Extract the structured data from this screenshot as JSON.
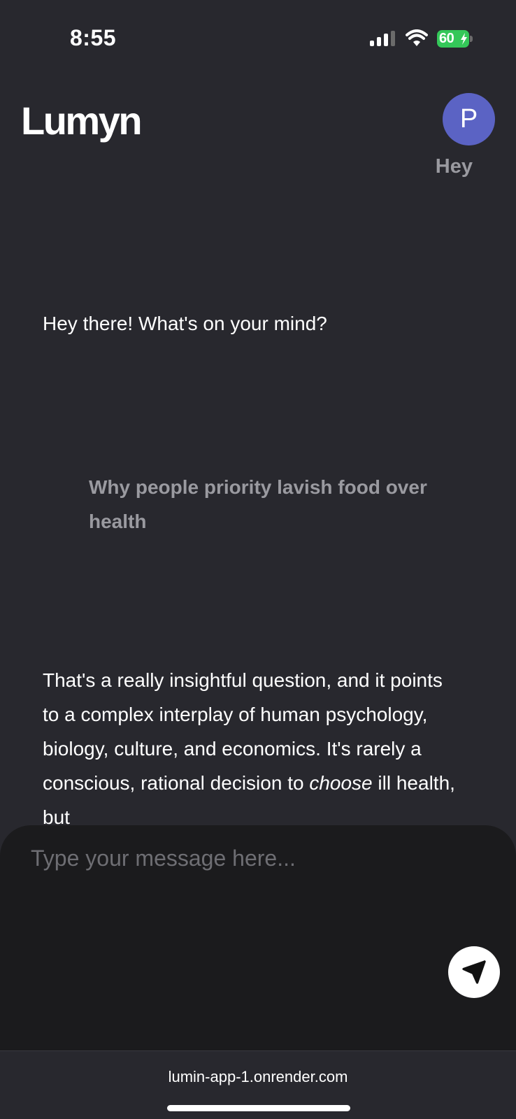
{
  "status_bar": {
    "time": "8:55",
    "battery_percent": "60",
    "signal_icon": "cellular-signal-icon",
    "wifi_icon": "wifi-icon",
    "battery_color": "#34c759"
  },
  "header": {
    "logo": "Lumyn",
    "avatar_initial": "P",
    "avatar_color": "#5b63c4"
  },
  "chat": {
    "messages": [
      {
        "role": "user",
        "text": "Hey"
      },
      {
        "role": "assistant",
        "text": "Hey there! What's on your mind?"
      },
      {
        "role": "user",
        "text": "Why people priority lavish food over health"
      },
      {
        "role": "assistant",
        "text_before": "That's a really insightful question, and it points to a complex interplay of human psychology, biology, culture, and economics. It's rarely a conscious, rational decision to ",
        "emphasis": "choose",
        "text_after": " ill health, but"
      }
    ]
  },
  "composer": {
    "placeholder": "Type your message here...",
    "value": "",
    "send_icon": "send-icon"
  },
  "browser": {
    "url": "lumin-app-1.onrender.com"
  }
}
